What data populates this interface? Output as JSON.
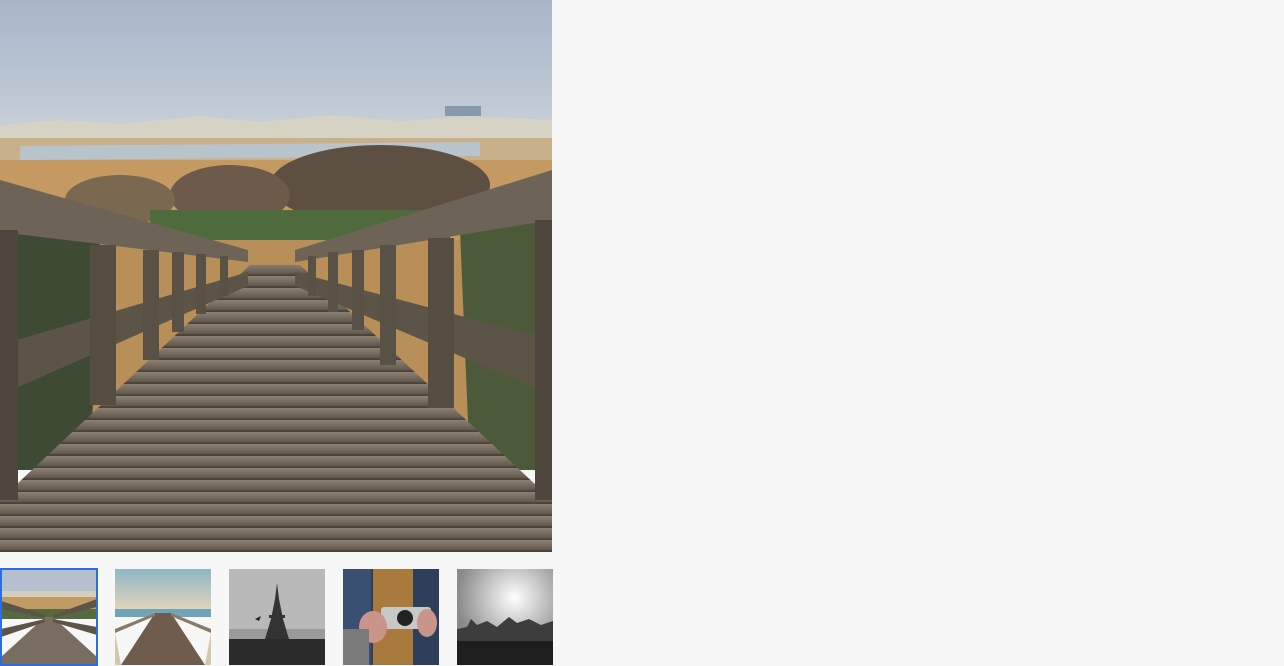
{
  "gallery": {
    "selected_index": 0,
    "main_image": {
      "icon": "boardwalk-photo"
    },
    "thumbnails": [
      {
        "icon": "boardwalk-dunes-thumbnail",
        "selected": true
      },
      {
        "icon": "pier-ocean-thumbnail",
        "selected": false
      },
      {
        "icon": "eiffel-tower-thumbnail",
        "selected": false
      },
      {
        "icon": "camera-hands-thumbnail",
        "selected": false
      },
      {
        "icon": "city-skyline-thumbnail",
        "selected": false
      }
    ]
  },
  "colors": {
    "background": "#f7f7f7",
    "selected_border": "#2a6fdb"
  }
}
